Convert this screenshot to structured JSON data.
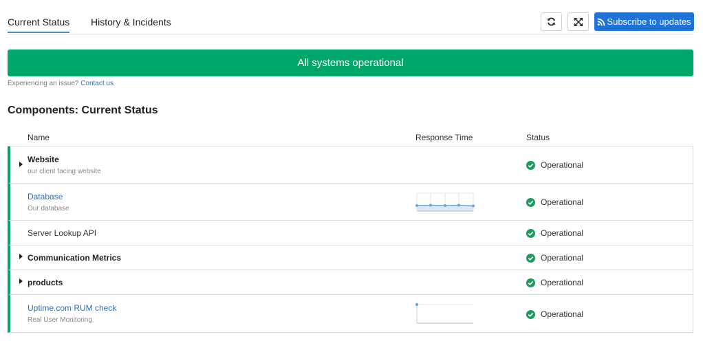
{
  "tabs": [
    {
      "label": "Current Status",
      "active": true
    },
    {
      "label": "History & Incidents",
      "active": false
    }
  ],
  "toolbar": {
    "subscribe_label": "Subscribe to updates",
    "refresh_icon": "refresh-icon",
    "expand_icon": "expand-icon"
  },
  "banner": {
    "text": "All systems operational",
    "color": "#00a76a"
  },
  "issue": {
    "prefix": "Experiencing an issue?",
    "link": "Contact us"
  },
  "section": {
    "title": "Components: Current Status"
  },
  "table": {
    "headers": {
      "name": "Name",
      "response_time": "Response Time",
      "status": "Status"
    },
    "rows": [
      {
        "name": "Website",
        "description": "our client facing website",
        "status": "Operational",
        "expandable": true
      },
      {
        "name": "Database",
        "description": "Our database",
        "status": "Operational",
        "expandable": false,
        "link": true
      },
      {
        "name": "Server Lookup API",
        "description": "",
        "status": "Operational",
        "expandable": false
      },
      {
        "name": "Communication Metrics",
        "description": "",
        "status": "Operational",
        "expandable": true
      },
      {
        "name": "products",
        "description": "",
        "status": "Operational",
        "expandable": true
      },
      {
        "name": "Uptime.com RUM check",
        "description": "Real User Monitoring",
        "status": "Operational",
        "expandable": false,
        "link": true
      }
    ]
  },
  "colors": {
    "operational": "#1a9c5b",
    "accent": "#1f72d6",
    "link": "#2f6fb5"
  }
}
